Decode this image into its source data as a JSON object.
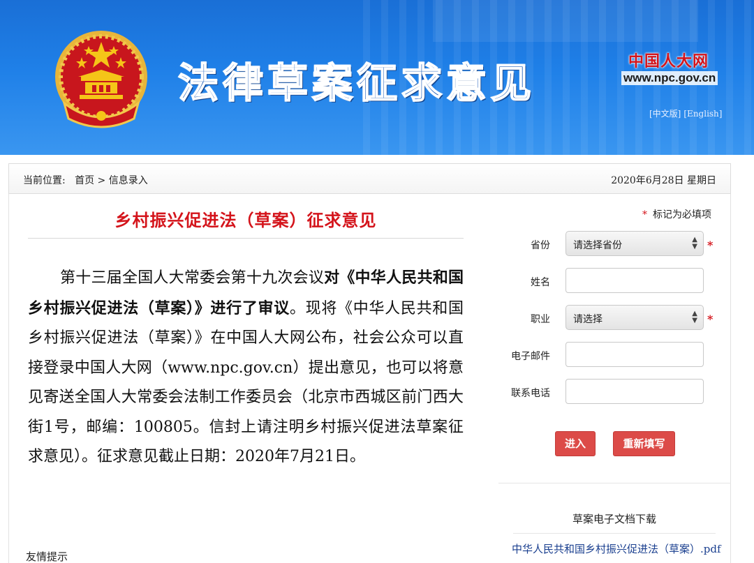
{
  "banner": {
    "title": "法律草案征求意见",
    "logo_text": "中国人大网",
    "logo_url": "www.npc.gov.cn",
    "lang_cn": "[中文版]",
    "lang_en": "[English]",
    "emblem_icon": "national-emblem-icon"
  },
  "breadcrumb": {
    "prefix": "当前位置:",
    "home": "首页",
    "separator": ">",
    "current": "信息录入",
    "date": "2020年6月28日 星期日"
  },
  "article": {
    "title": "乡村振兴促进法（草案）征求意见",
    "body_part1": "第十三届全国人大常委会第十九次会议",
    "body_bold1": "对《中华人民共和国乡村振兴促进法（草案）》进行了审议",
    "body_part2": "。现将《中华人民共和国乡村振兴促进法（草案）》在中国人大网公布，社会公众可以直接登录中国人大网（www.npc.gov.cn）提出意见，也可以将意见寄送全国人大常委会法制工作委员会（北京市西城区前门西大街1号，邮编：100805。信封上请注明乡村振兴促进法草案征求意见）。征求意见截止日期：2020年7月21日。"
  },
  "form": {
    "required_star": "*",
    "required_note": "标记为必填项",
    "province_label": "省份",
    "province_value": "请选择省份",
    "name_label": "姓名",
    "name_value": "",
    "job_label": "职业",
    "job_value": "请选择",
    "email_label": "电子邮件",
    "email_value": "",
    "phone_label": "联系电话",
    "phone_value": "",
    "submit_label": "进入",
    "reset_label": "重新填写"
  },
  "download": {
    "heading": "草案电子文档下载",
    "link": "中华人民共和国乡村振兴促进法（草案）.pdf"
  },
  "footer": {
    "tip_label": "友情提示"
  },
  "colors": {
    "banner_blue": "#1f80e8",
    "title_red": "#d4141b",
    "button_red": "#dc4b48",
    "link_blue": "#1a3f8f"
  }
}
